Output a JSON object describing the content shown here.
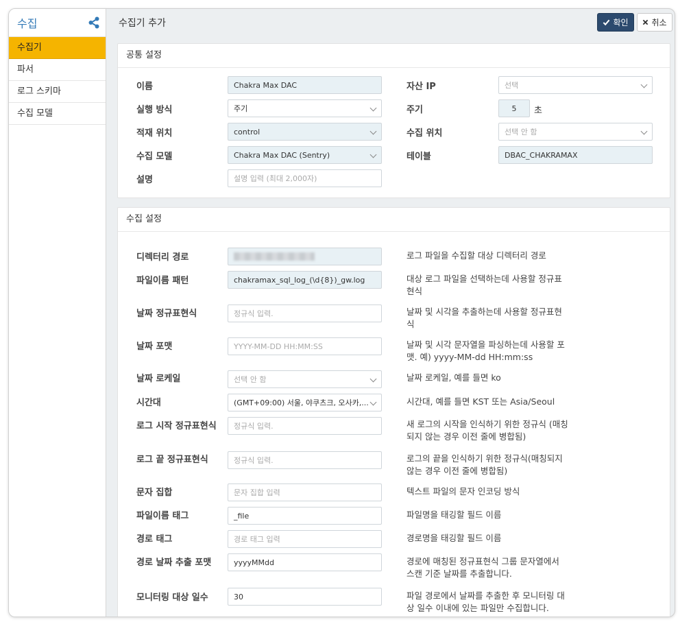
{
  "sidebar": {
    "title": "수집",
    "items": [
      {
        "label": "수집기",
        "active": true
      },
      {
        "label": "파서"
      },
      {
        "label": "로그 스키마"
      },
      {
        "label": "수집 모델"
      }
    ]
  },
  "header": {
    "title": "수집기 추가",
    "confirm_label": "확인",
    "cancel_label": "취소"
  },
  "common": {
    "title": "공통 설정",
    "name_label": "이름",
    "name_value": "Chakra Max DAC",
    "asset_ip_label": "자산 IP",
    "asset_ip_placeholder": "선택",
    "run_mode_label": "실행 방식",
    "run_mode_value": "주기",
    "period_label": "주기",
    "period_value": "5",
    "period_unit": "초",
    "load_location_label": "적재 위치",
    "load_location_value": "control",
    "collect_location_label": "수집 위치",
    "collect_location_placeholder": "선택 안 함",
    "collect_model_label": "수집 모델",
    "collect_model_value": "Chakra Max DAC (Sentry)",
    "table_label": "테이블",
    "table_value": "DBAC_CHAKRAMAX",
    "description_label": "설명",
    "description_placeholder": "설명 입력 (최대 2,000자)"
  },
  "collect": {
    "title": "수집 설정",
    "rows": [
      {
        "label": "디렉터리 경로",
        "value": "",
        "placeholder": "",
        "desc": "로그 파일을 수집할 대상 디렉터리 경로"
      },
      {
        "label": "파일이름 패턴",
        "value": "chakramax_sql_log_(\\d{8})_gw.log",
        "placeholder": "",
        "desc": "대상 로그 파일을 선택하는데 사용할 정규표현식"
      },
      {
        "label": "날짜 정규표현식",
        "value": "",
        "placeholder": "정규식 입력.",
        "desc": "날짜 및 시각을 추출하는데 사용할 정규표현식"
      },
      {
        "label": "날짜 포맷",
        "value": "",
        "placeholder": "YYYY-MM-DD HH:MM:SS",
        "desc": "날짜 및 시각 문자열을 파싱하는데 사용할 포맷. 예) yyyy-MM-dd HH:mm:ss"
      },
      {
        "label": "날짜 로케일",
        "value": "",
        "placeholder": "선택 안 함",
        "desc": "날짜 로케일, 예를 들면 ko"
      },
      {
        "label": "시간대",
        "value": "(GMT+09:00) 서울, 야쿠츠크, 오사카,...",
        "placeholder": "",
        "desc": "시간대, 예를 들면 KST 또는 Asia/Seoul"
      },
      {
        "label": "로그 시작 정규표현식",
        "value": "",
        "placeholder": "정규식 입력.",
        "desc": "새 로그의 시작을 인식하기 위한 정규식 (매칭되지 않는 경우 이전 줄에 병합됨)"
      },
      {
        "label": "로그 끝 정규표현식",
        "value": "",
        "placeholder": "정규식 입력.",
        "desc": "로그의 끝을 인식하기 위한 정규식(매칭되지 않는 경우 이전 줄에 병합됨)"
      },
      {
        "label": "문자 집합",
        "value": "",
        "placeholder": "문자 집합 입력",
        "desc": "텍스트 파일의 문자 인코딩 방식"
      },
      {
        "label": "파일이름 태그",
        "value": "_file",
        "placeholder": "",
        "desc": "파일명을 태깅할 필드 이름"
      },
      {
        "label": "경로 태그",
        "value": "",
        "placeholder": "경로 태그 입력",
        "desc": "경로명을 태깅할 필드 이름"
      },
      {
        "label": "경로 날짜 추출 포맷",
        "value": "yyyyMMdd",
        "placeholder": "",
        "desc": "경로에 매칭된 정규표현식 그룹 문자열에서 스캔 기준 날짜를 추출합니다."
      },
      {
        "label": "모니터링 대상 일수",
        "value": "30",
        "placeholder": "",
        "desc": "파일 경로에서 날짜를 추출한 후 모니터링 대상 일수 이내에 있는 파일만 수집합니다."
      }
    ]
  },
  "colors": {
    "accent": "#337ab7",
    "active_item": "#f5b400",
    "confirm_button": "#2c4a6e"
  },
  "icons": [
    "share-icon",
    "check-icon",
    "close-icon",
    "chevron-down-icon"
  ]
}
